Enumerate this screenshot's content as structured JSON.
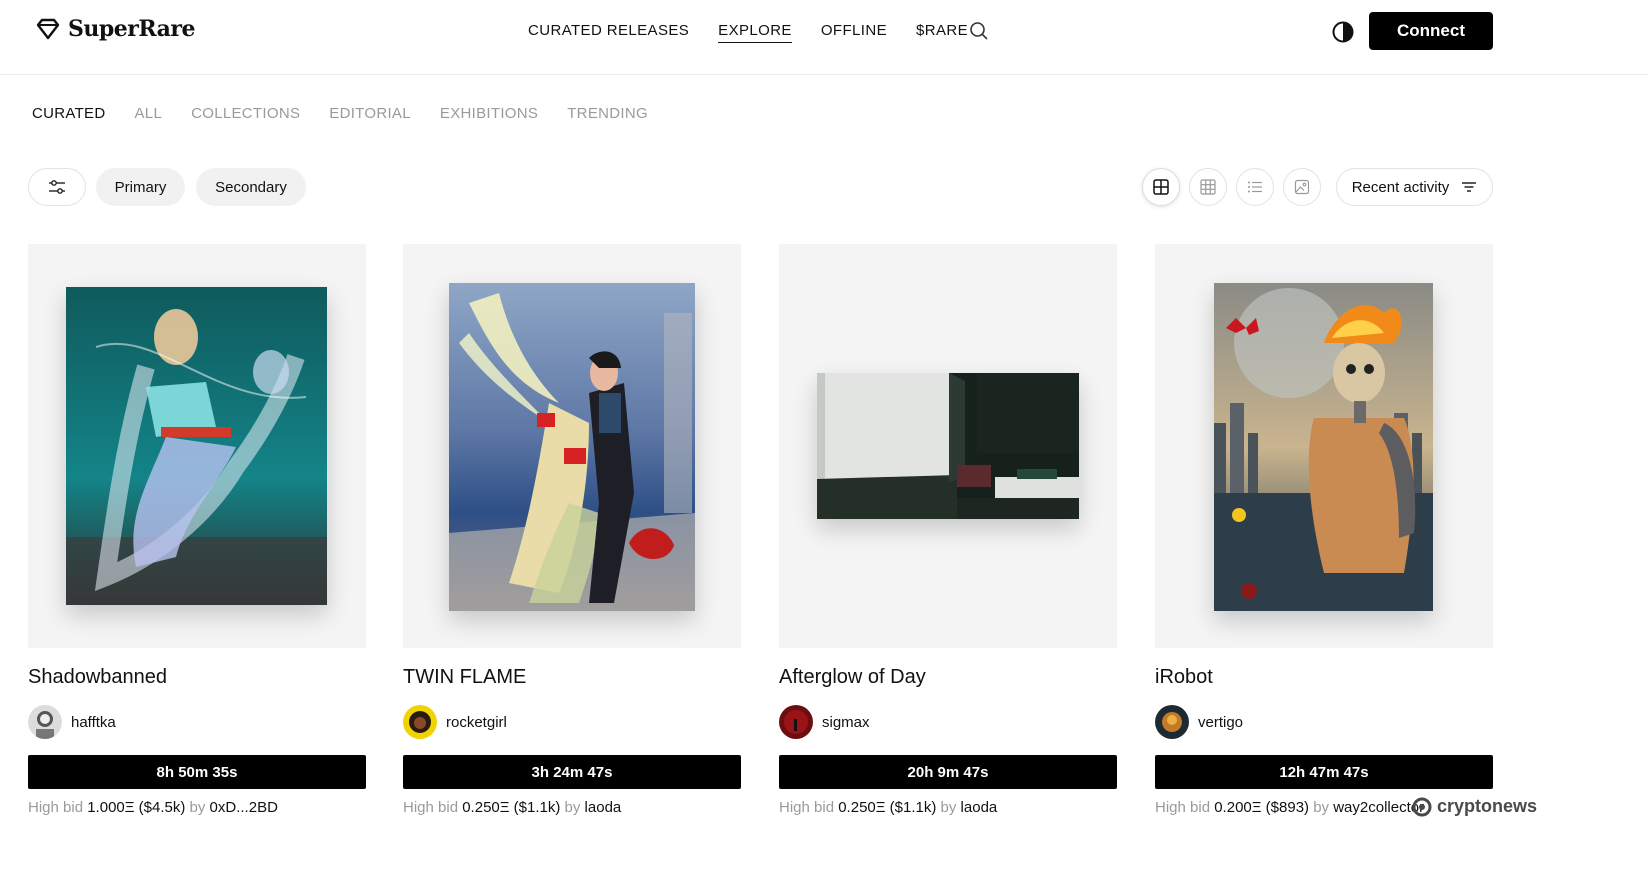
{
  "header": {
    "brand": "SuperRare",
    "nav": [
      "CURATED RELEASES",
      "EXPLORE",
      "OFFLINE",
      "$RARE"
    ],
    "active_nav": "EXPLORE",
    "connect_label": "Connect"
  },
  "subnav": {
    "tabs": [
      "CURATED",
      "ALL",
      "COLLECTIONS",
      "EDITORIAL",
      "EXHIBITIONS",
      "TRENDING"
    ],
    "active": "CURATED"
  },
  "filters": {
    "primary_label": "Primary",
    "secondary_label": "Secondary",
    "sort_label": "Recent activity"
  },
  "cards": [
    {
      "title": "Shadowbanned",
      "artist": "hafftka",
      "timer": "8h 50m 35s",
      "bid_prefix": "High bid",
      "bid_amount": "1.000Ξ ($4.5k)",
      "bid_by": "by",
      "bidder": "0xD...2BD"
    },
    {
      "title": "TWIN FLAME",
      "artist": "rocketgirl",
      "timer": "3h 24m 47s",
      "bid_prefix": "High bid",
      "bid_amount": "0.250Ξ ($1.1k)",
      "bid_by": "by",
      "bidder": "laoda"
    },
    {
      "title": "Afterglow of Day",
      "artist": "sigmax",
      "timer": "20h 9m 47s",
      "bid_prefix": "High bid",
      "bid_amount": "0.250Ξ ($1.1k)",
      "bid_by": "by",
      "bidder": "laoda"
    },
    {
      "title": "iRobot",
      "artist": "vertigo",
      "timer": "12h 47m 47s",
      "bid_prefix": "High bid",
      "bid_amount": "0.200Ξ ($893)",
      "bid_by": "by",
      "bidder": "way2collector"
    }
  ],
  "watermark": "cryptonews",
  "colors": {
    "accent": "#000000",
    "muted": "#9a9a9a",
    "card_bg": "#f4f4f4"
  }
}
